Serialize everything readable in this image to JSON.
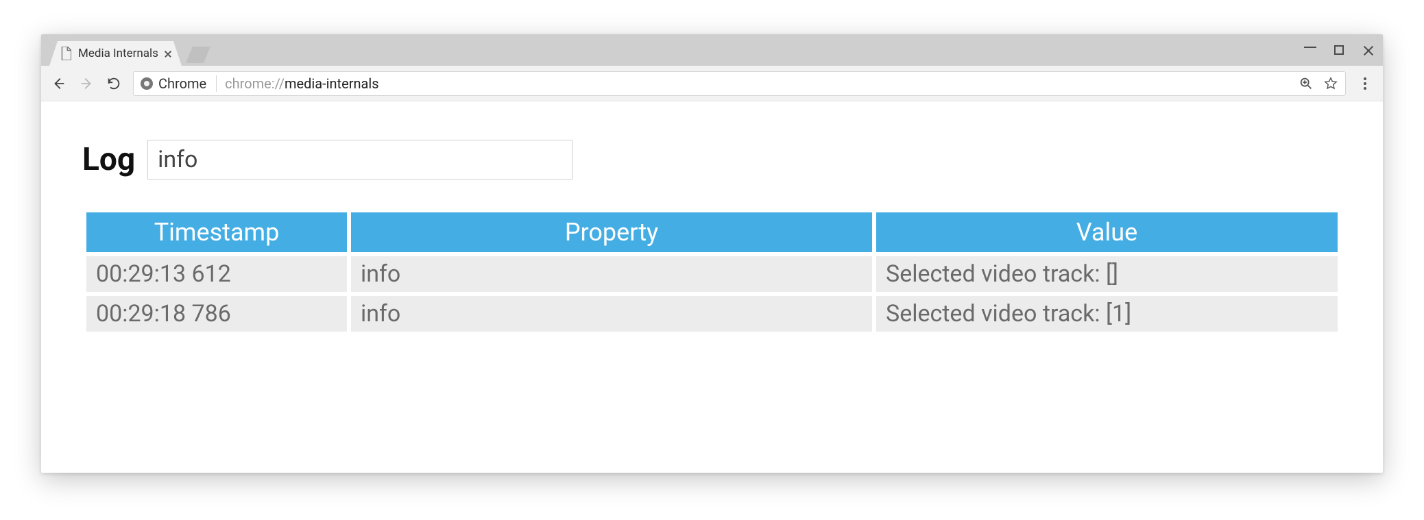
{
  "browser": {
    "tab_title": "Media Internals",
    "omnibox": {
      "origin_label": "Chrome",
      "scheme": "chrome://",
      "path": "media-internals"
    }
  },
  "page": {
    "heading": "Log",
    "filter_value": "info",
    "columns": [
      "Timestamp",
      "Property",
      "Value"
    ],
    "rows": [
      {
        "timestamp": "00:29:13 612",
        "property": "info",
        "value": "Selected video track: []"
      },
      {
        "timestamp": "00:29:18 786",
        "property": "info",
        "value": "Selected video track: [1]"
      }
    ]
  }
}
